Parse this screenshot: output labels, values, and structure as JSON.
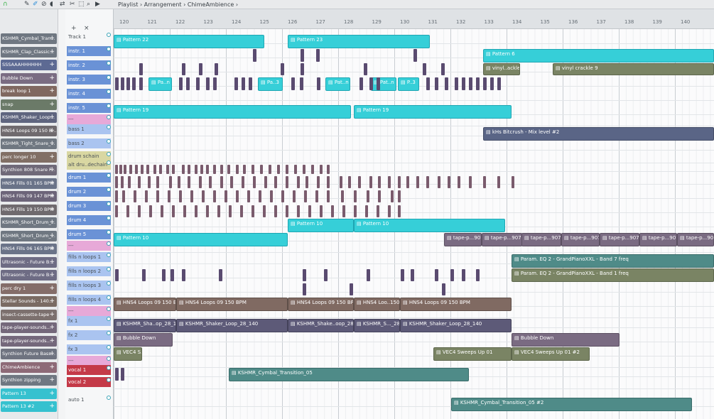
{
  "window": {
    "title_parts": [
      "Playlist",
      "Arrangement",
      "ChimeAmbience"
    ]
  },
  "toolbar_icons": [
    "magnet-icon",
    "pencil-icon",
    "paint-icon",
    "delete-icon",
    "mute-icon",
    "slip-icon",
    "slice-icon",
    "select-icon",
    "zoom-icon",
    "play-icon"
  ],
  "ruler": {
    "ticks": [
      "120",
      "121",
      "122",
      "123",
      "124",
      "125",
      "126",
      "127",
      "128",
      "129",
      "130",
      "131",
      "132",
      "133",
      "134",
      "135",
      "136",
      "137",
      "138",
      "139",
      "140"
    ]
  },
  "browser": {
    "items": [
      {
        "label": "KSHMR_Cymbal_Tran...",
        "color": "#6f7781"
      },
      {
        "label": "KSHMR_Clap_Classic...",
        "color": "#6f7781"
      },
      {
        "label": "SSSAAAHHHHHH",
        "color": "#5d6a93"
      },
      {
        "label": "Bubble Down",
        "color": "#7a6c82"
      },
      {
        "label": "break loop 1",
        "color": "#806860"
      },
      {
        "label": "snap",
        "color": "#6b7a68"
      },
      {
        "label": "KSHMR_Shaker_Loop...",
        "color": "#5f657f"
      },
      {
        "label": "HNS4 Loops 09 150 B...",
        "color": "#6f6a6e"
      },
      {
        "label": "KSHMR_Tight_Snare_...",
        "color": "#6f7781"
      },
      {
        "label": "perc longer 10",
        "color": "#816f65"
      },
      {
        "label": "Synthion 808 Snare F...",
        "color": "#6f6978"
      },
      {
        "label": "HNS4 Fills 01 165 BPM",
        "color": "#6a7388"
      },
      {
        "label": "HNS4 Fills 09 147 BPM",
        "color": "#6c6479"
      },
      {
        "label": "HNS4 Fills 19 150 BPM",
        "color": "#6f6a6e"
      },
      {
        "label": "KSHMR_Short_Drum_...",
        "color": "#6f7781"
      },
      {
        "label": "KSHMR_Short_Drum_...",
        "color": "#6f7781"
      },
      {
        "label": "HNS4 Fills 06 165 BPM",
        "color": "#6a7388"
      },
      {
        "label": "Ultrasonic - Future B...",
        "color": "#6e6c84"
      },
      {
        "label": "Ultrasonic - Future B...",
        "color": "#6e6c84"
      },
      {
        "label": "perc dry 1",
        "color": "#846d69"
      },
      {
        "label": "Stellar Sounds - 140...",
        "color": "#7a6b63"
      },
      {
        "label": "insect-cassette-tape",
        "color": "#7c706e"
      },
      {
        "label": "tape-player-sounds...",
        "color": "#74687b"
      },
      {
        "label": "tape-player-sounds...",
        "color": "#74687b"
      },
      {
        "label": "Synthion Future Bass...",
        "color": "#6f7380"
      },
      {
        "label": "ChimeAmbience",
        "color": "#8d6a77"
      },
      {
        "label": "Synthion zipping",
        "color": "#6f7781"
      },
      {
        "label": "Pattern 13",
        "color": "#36c1cf"
      },
      {
        "label": "Pattern 13 #2",
        "color": "#36c1cf"
      }
    ]
  },
  "tracks": [
    {
      "label": "Track 1",
      "color": "#f6f7f8"
    },
    {
      "label": "instr. 1",
      "color": "#6a92d6"
    },
    {
      "label": "instr. 2",
      "color": "#6a92d6"
    },
    {
      "label": "instr. 3",
      "color": "#6a92d6"
    },
    {
      "label": "instr. 4",
      "color": "#6a92d6"
    },
    {
      "label": "instr. 5",
      "color": "#6a92d6"
    },
    {
      "label": "---",
      "color": "#e7a9d8"
    },
    {
      "label": "bass 1",
      "color": "#aac4f0"
    },
    {
      "label": "bass 2",
      "color": "#aac4f0"
    },
    {
      "label": "drum schain",
      "color": "#d9d7a2"
    },
    {
      "label": "alt dru..dechain",
      "color": "#d9d7a2"
    },
    {
      "label": "drum 1",
      "color": "#6a92d6"
    },
    {
      "label": "drum 2",
      "color": "#6a92d6"
    },
    {
      "label": "drum 3",
      "color": "#6a92d6"
    },
    {
      "label": "drum 4",
      "color": "#6a92d6"
    },
    {
      "label": "drum 5",
      "color": "#6a92d6"
    },
    {
      "label": "---",
      "color": "#e7a9d8"
    },
    {
      "label": "fills n loops 1",
      "color": "#aac4f0"
    },
    {
      "label": "fills n loops 2",
      "color": "#aac4f0"
    },
    {
      "label": "fills n loops 3",
      "color": "#aac4f0"
    },
    {
      "label": "fills n loops 4",
      "color": "#aac4f0"
    },
    {
      "label": "---",
      "color": "#e7a9d8"
    },
    {
      "label": "fx 1",
      "color": "#aac4f0"
    },
    {
      "label": "fx 2",
      "color": "#aac4f0"
    },
    {
      "label": "fx 3",
      "color": "#aac4f0"
    },
    {
      "label": "---",
      "color": "#e7a9d8"
    },
    {
      "label": "vocal 1",
      "color": "#c43a48"
    },
    {
      "label": "vocal 2",
      "color": "#c43a48"
    },
    {
      "label": "auto 1",
      "color": "#f6f7f8"
    }
  ],
  "clips": [
    {
      "label": "Pattern 22",
      "style": "cyan"
    },
    {
      "label": "Pattern 23",
      "style": "cyan"
    },
    {
      "label": "Pattern 6",
      "style": "cyan"
    },
    {
      "label": "vinyl..ackle",
      "style": "olive"
    },
    {
      "label": "vinyl crackle 9",
      "style": "olive"
    },
    {
      "label": "Pa..n 3",
      "style": "cyan"
    },
    {
      "label": "Pa..3",
      "style": "cyan"
    },
    {
      "label": "Pat..n 3",
      "style": "cyan"
    },
    {
      "label": "Pat..n 3",
      "style": "cyan"
    },
    {
      "label": "P..3",
      "style": "cyan"
    },
    {
      "label": "Pattern 19",
      "style": "cyan"
    },
    {
      "label": "Pattern 19",
      "style": "cyan"
    },
    {
      "label": "kHs Bitcrush - Mix level #2",
      "style": "navy"
    },
    {
      "label": "Pattern 10",
      "style": "cyan"
    },
    {
      "label": "Pattern 10",
      "style": "cyan"
    },
    {
      "label": "Pattern 10",
      "style": "cyan"
    },
    {
      "label": "tape-p...9078",
      "style": "mauve"
    },
    {
      "label": "tape-p...90780",
      "style": "mauve"
    },
    {
      "label": "tape-p...90780",
      "style": "mauve"
    },
    {
      "label": "tape-p...90780",
      "style": "mauve"
    },
    {
      "label": "tape-p...90780",
      "style": "mauve"
    },
    {
      "label": "tape-p...90780",
      "style": "mauve"
    },
    {
      "label": "tape-p...90780",
      "style": "mauve"
    },
    {
      "label": "Param. EQ 2 - GrandPianoXXL - Band 7 freq",
      "style": "teal"
    },
    {
      "label": "Param. EQ 2 - GrandPianoXXL - Band 1 freq",
      "style": "olive"
    },
    {
      "label": "HNS4 Loops 09 150 BPM",
      "style": "brown"
    },
    {
      "label": "HNS4 Loops 09 150 BPM",
      "style": "brown"
    },
    {
      "label": "HNS4 Loops 09 150 BPM",
      "style": "brown"
    },
    {
      "label": "HNS4 Loo..150 BPM",
      "style": "brown"
    },
    {
      "label": "HNS4 Loops 09 150 BPM",
      "style": "brown"
    },
    {
      "label": "KSHMR_Sha..op_28_140",
      "style": "purple"
    },
    {
      "label": "KSHMR_Shaker_Loop_28_140",
      "style": "purple"
    },
    {
      "label": "KSHMR_Shake..oop_28_140",
      "style": "purple"
    },
    {
      "label": "KSHMR_S..._28_140",
      "style": "purple"
    },
    {
      "label": "KSHMR_Shaker_Loop_28_140",
      "style": "purple"
    },
    {
      "label": "Bubble Down",
      "style": "mauve"
    },
    {
      "label": "Bubble Down",
      "style": "mauve"
    },
    {
      "label": "VEC4 S..#2",
      "style": "olive"
    },
    {
      "label": "VEC4 Sweeps Up 01",
      "style": "olive"
    },
    {
      "label": "VEC4 Sweeps Up 01 #2",
      "style": "olive"
    },
    {
      "label": "KSHMR_Cymbal_Transition_05",
      "style": "teal"
    },
    {
      "label": "KSHMR_Cymbal_Transition_05 #2",
      "style": "teal"
    }
  ]
}
